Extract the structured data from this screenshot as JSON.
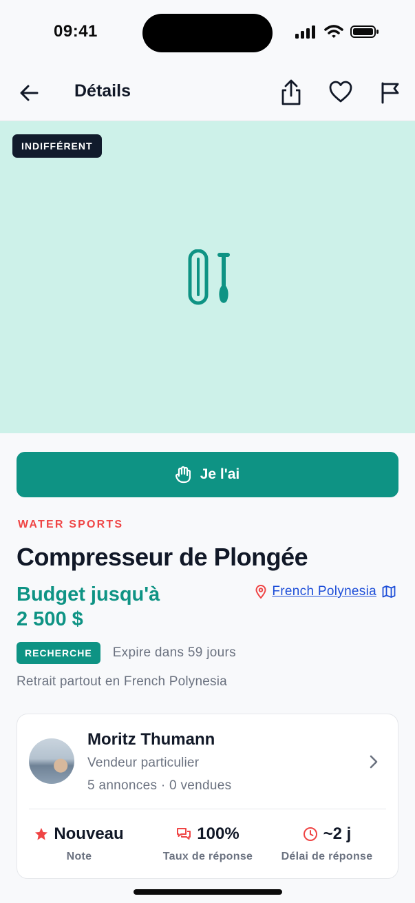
{
  "status_bar": {
    "time": "09:41"
  },
  "nav": {
    "title": "Détails"
  },
  "hero": {
    "badge": "INDIFFÉRENT",
    "background_color": "#cdf1e9"
  },
  "cta": {
    "label": "Je l'ai",
    "color": "#0e9384"
  },
  "listing": {
    "category": "WATER SPORTS",
    "title": "Compresseur de Plongée",
    "budget_line1": "Budget jusqu'à",
    "budget_line2": "2 500 $",
    "location": "French Polynesia",
    "tag": "RECHERCHE",
    "expires": "Expire dans 59 jours",
    "pickup": "Retrait partout en French Polynesia"
  },
  "seller": {
    "name": "Moritz Thumann",
    "type": "Vendeur particulier",
    "stats": "5 annonces · 0 vendues",
    "metrics": [
      {
        "value": "Nouveau",
        "label": "Note",
        "icon": "star-icon"
      },
      {
        "value": "100%",
        "label": "Taux de réponse",
        "icon": "chat-bubbles-icon"
      },
      {
        "value": "~2 j",
        "label": "Délai de réponse",
        "icon": "clock-icon"
      }
    ]
  },
  "colors": {
    "accent": "#0e9384",
    "category": "#ef4444",
    "link": "#1d4ed8",
    "dark_badge": "#111b2c"
  }
}
